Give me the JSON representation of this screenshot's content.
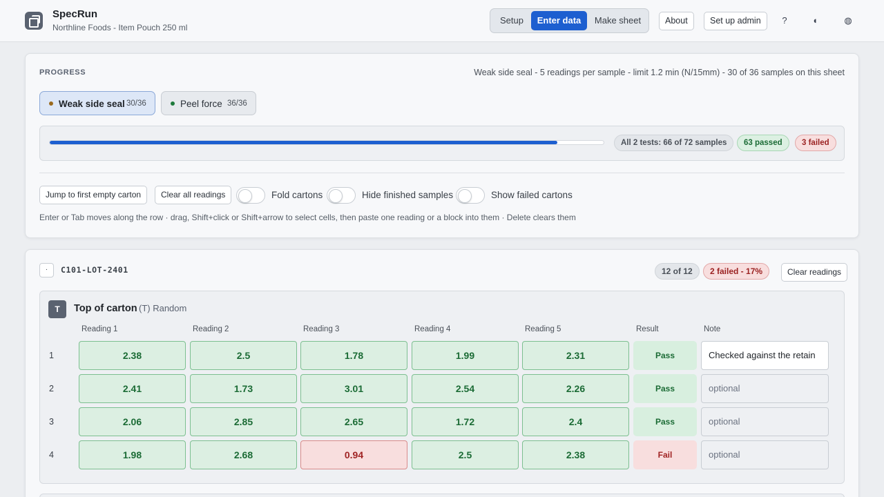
{
  "app": {
    "name": "SpecRun",
    "subtitle": "Northline Foods - Item Pouch 250 ml"
  },
  "header": {
    "modes": [
      {
        "label": "Setup",
        "active": false
      },
      {
        "label": "Enter data",
        "active": true
      },
      {
        "label": "Make sheet",
        "active": false
      }
    ],
    "about_label": "About",
    "admin_label": "Set up admin",
    "help_icon": "?",
    "theme_icon": "◖",
    "palette_icon": "◍"
  },
  "progress": {
    "section_label": "PROGRESS",
    "summary": "Weak side seal - 5 readings per sample - limit 1.2 min (N/15mm) - 30 of 36 samples on this sheet",
    "tests": [
      {
        "label": "Weak side seal",
        "count": "30/36",
        "active": true,
        "dot_color": "#9a6a1e"
      },
      {
        "label": "Peel force",
        "count": "36/36",
        "active": false,
        "dot_color": "#1e7a3c"
      }
    ],
    "overall_fraction": 0.9167,
    "overall_label": "All 2 tests: 66 of 72 samples",
    "passed_label": "63 passed",
    "failed_label": "3 failed"
  },
  "actions": {
    "jump_label": "Jump to first empty carton",
    "clear_all_label": "Clear all readings",
    "fold_label": "Fold cartons",
    "hide_label": "Hide finished samples",
    "show_failed_label": "Show failed cartons",
    "hint": "Enter or Tab moves along the row · drag, Shift+click or Shift+arrow to select cells, then paste one reading or a block into them · Delete clears them"
  },
  "lot": {
    "collapse_icon": "·",
    "id": "C101-LOT-2401",
    "count_label": "12 of 12",
    "failed_label": "2 failed - 17%",
    "clear_label": "Clear readings",
    "group": {
      "icon": "T",
      "title": "Top of carton",
      "subtitle": "(T) Random",
      "columns": [
        "Reading 1",
        "Reading 2",
        "Reading 3",
        "Reading 4",
        "Reading 5",
        "Result",
        "Note"
      ],
      "rows": [
        {
          "num": "1",
          "readings": [
            {
              "v": "2.38",
              "s": "pass"
            },
            {
              "v": "2.5",
              "s": "pass"
            },
            {
              "v": "1.78",
              "s": "pass"
            },
            {
              "v": "1.99",
              "s": "pass"
            },
            {
              "v": "2.31",
              "s": "pass"
            }
          ],
          "result": "Pass",
          "result_state": "pass",
          "note": "Checked against the retain",
          "note_placeholder": false
        },
        {
          "num": "2",
          "readings": [
            {
              "v": "2.41",
              "s": "pass"
            },
            {
              "v": "1.73",
              "s": "pass"
            },
            {
              "v": "3.01",
              "s": "pass"
            },
            {
              "v": "2.54",
              "s": "pass"
            },
            {
              "v": "2.26",
              "s": "pass"
            }
          ],
          "result": "Pass",
          "result_state": "pass",
          "note": "optional",
          "note_placeholder": true
        },
        {
          "num": "3",
          "readings": [
            {
              "v": "2.06",
              "s": "pass"
            },
            {
              "v": "2.85",
              "s": "pass"
            },
            {
              "v": "2.65",
              "s": "pass"
            },
            {
              "v": "1.72",
              "s": "pass"
            },
            {
              "v": "2.4",
              "s": "pass"
            }
          ],
          "result": "Pass",
          "result_state": "pass",
          "note": "optional",
          "note_placeholder": true
        },
        {
          "num": "4",
          "readings": [
            {
              "v": "1.98",
              "s": "pass"
            },
            {
              "v": "2.68",
              "s": "pass"
            },
            {
              "v": "0.94",
              "s": "fail"
            },
            {
              "v": "2.5",
              "s": "pass"
            },
            {
              "v": "2.38",
              "s": "pass"
            }
          ],
          "result": "Fail",
          "result_state": "fail",
          "note": "optional",
          "note_placeholder": true
        }
      ]
    }
  }
}
